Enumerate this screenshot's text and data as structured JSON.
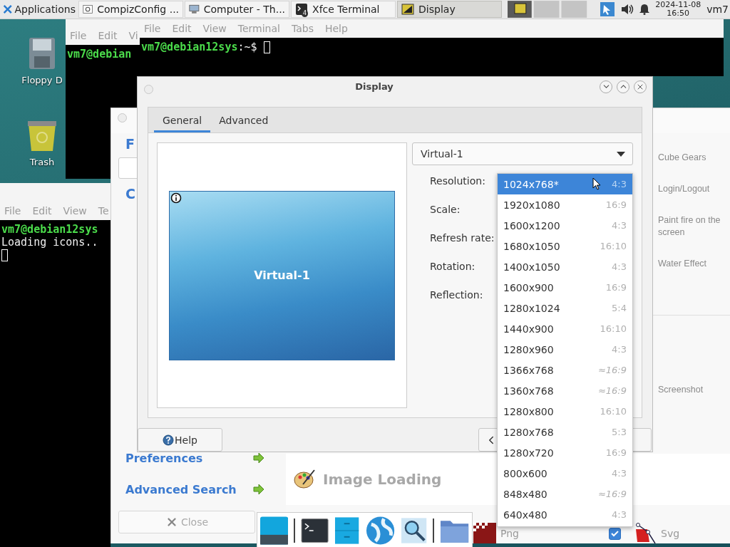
{
  "top_panel": {
    "menu_label": "Applications",
    "tasks": [
      {
        "label": "CompizConfig ...",
        "selected": false,
        "kind": "settings"
      },
      {
        "label": "Computer - Th...",
        "selected": false,
        "kind": "computer"
      },
      {
        "label": "Xfce Terminal",
        "selected": false,
        "kind": "terminal",
        "badge": "4"
      },
      {
        "label": "Display",
        "selected": true,
        "kind": "display"
      }
    ],
    "clock": {
      "date": "2024-11-08",
      "time": "16:50"
    },
    "user": "vm7"
  },
  "desktop_icons": [
    {
      "label": "Floppy D",
      "kind": "floppy"
    },
    {
      "label": "Trash",
      "kind": "trash"
    }
  ],
  "terminal_back": {
    "menu": [
      "File",
      "Edit",
      "Vi"
    ],
    "prompt": "vm7@debian"
  },
  "terminal_front": {
    "menu": [
      "File",
      "Edit",
      "View",
      "Terminal",
      "Tabs",
      "Help"
    ],
    "prompt_user": "vm7@debian12sys",
    "prompt_path": ":~$"
  },
  "compiz": {
    "heading": "F",
    "section": "C",
    "links": [
      "Preferences",
      "Advanced Search"
    ],
    "close_button": "Close",
    "plugins": [
      "Cube Gears",
      "Login/Logout",
      "Paint fire on the screen",
      "Water Effect"
    ],
    "plugins_2": [
      "Screenshot"
    ],
    "category": "Image Loading",
    "formats": [
      {
        "label": "Png",
        "kind": "png",
        "checked": true
      },
      {
        "label": "Svg",
        "kind": "svg"
      }
    ]
  },
  "terminal_small": {
    "menu": [
      "File",
      "Edit",
      "View",
      "Te"
    ],
    "prompt": "vm7@debian12sys",
    "lines": [
      "Loading icons.."
    ]
  },
  "display": {
    "title": "Display",
    "tabs": [
      {
        "label": "General",
        "selected": true
      },
      {
        "label": "Advanced",
        "selected": false
      }
    ],
    "monitor": {
      "name": "Virtual-1"
    },
    "output_combo": "Virtual-1",
    "labels": [
      "Resolution:",
      "Scale:",
      "Refresh rate:",
      "Rotation:",
      "Reflection:"
    ],
    "help_button": "Help"
  },
  "resolution_menu": [
    {
      "resolution": "1024x768*",
      "aspect": "4:3",
      "selected": true,
      "approximate": false
    },
    {
      "resolution": "1920x1080",
      "aspect": "16:9",
      "selected": false,
      "approximate": false
    },
    {
      "resolution": "1600x1200",
      "aspect": "4:3",
      "selected": false,
      "approximate": false
    },
    {
      "resolution": "1680x1050",
      "aspect": "16:10",
      "selected": false,
      "approximate": false
    },
    {
      "resolution": "1400x1050",
      "aspect": "4:3",
      "selected": false,
      "approximate": false
    },
    {
      "resolution": "1600x900",
      "aspect": "16:9",
      "selected": false,
      "approximate": false
    },
    {
      "resolution": "1280x1024",
      "aspect": "5:4",
      "selected": false,
      "approximate": false
    },
    {
      "resolution": "1440x900",
      "aspect": "16:10",
      "selected": false,
      "approximate": false
    },
    {
      "resolution": "1280x960",
      "aspect": "4:3",
      "selected": false,
      "approximate": false
    },
    {
      "resolution": "1366x768",
      "aspect": "≈16:9",
      "selected": false,
      "approximate": true
    },
    {
      "resolution": "1360x768",
      "aspect": "≈16:9",
      "selected": false,
      "approximate": true
    },
    {
      "resolution": "1280x800",
      "aspect": "16:10",
      "selected": false,
      "approximate": false
    },
    {
      "resolution": "1280x768",
      "aspect": "5:3",
      "selected": false,
      "approximate": false
    },
    {
      "resolution": "1280x720",
      "aspect": "16:9",
      "selected": false,
      "approximate": false
    },
    {
      "resolution": "800x600",
      "aspect": "4:3",
      "selected": false,
      "approximate": false
    },
    {
      "resolution": "848x480",
      "aspect": "≈16:9",
      "selected": false,
      "approximate": true
    },
    {
      "resolution": "640x480",
      "aspect": "4:3",
      "selected": false,
      "approximate": false
    }
  ]
}
